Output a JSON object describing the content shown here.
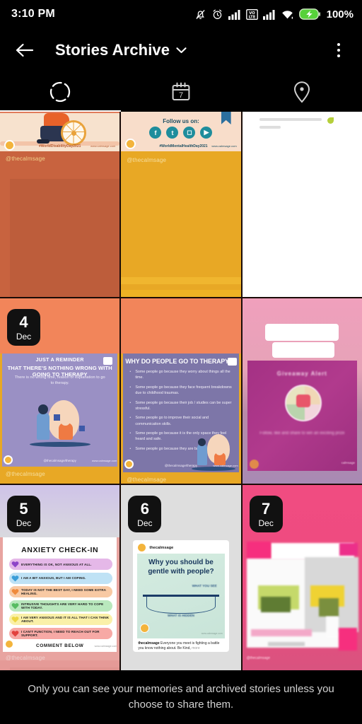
{
  "status_bar": {
    "time": "3:10 PM",
    "battery_percent": "100%",
    "icons": [
      "bell-slash-icon",
      "alarm-clock-icon",
      "signal-bars-icon",
      "volte-icon",
      "signal-bars-2-icon",
      "wifi-icon",
      "battery-charging-icon"
    ],
    "volte_label_top": "VO",
    "volte_label_bottom": "LTE"
  },
  "header": {
    "back_icon": "back-arrow-icon",
    "title": "Stories Archive",
    "chevron_icon": "chevron-down-icon",
    "menu_icon": "kebab-menu-icon"
  },
  "tabs": {
    "items": [
      {
        "name": "stories",
        "icon": "dashed-circle-icon",
        "selected": true
      },
      {
        "name": "calendar",
        "icon": "calendar-icon",
        "label": "7",
        "selected": false
      },
      {
        "name": "map",
        "icon": "location-pin-icon",
        "selected": false
      }
    ]
  },
  "grid": {
    "cells": [
      {
        "id": "cell-1",
        "type": "story-thumb",
        "date": null,
        "watermark": "@thecalmsage",
        "hashtag": "#WorldDisabilityDay2021",
        "site": "www.calmsage.com",
        "bg": "#c8633f"
      },
      {
        "id": "cell-2",
        "type": "story-thumb",
        "date": null,
        "heading": "Follow us on:",
        "socials": [
          "f",
          "t",
          "ig",
          "yt"
        ],
        "hashtag": "#WorldMentalHealthDay2021",
        "site": "www.calmsage.com",
        "watermark": "@thecalmsage",
        "bg": "#e8a825"
      },
      {
        "id": "cell-3",
        "type": "story-thumb",
        "date": null,
        "bg": "#ffffff"
      },
      {
        "id": "cell-4",
        "type": "story-thumb",
        "date": {
          "day": "4",
          "month": "Dec"
        },
        "title_line1": "JUST A REMINDER",
        "title_line2": "THAT THERE'S NOTHING WRONG WITH GOING TO THERAPY",
        "body": "There is no wrong time, reason or explanation to go to therapy.",
        "credit": "@thecalmsage/therapy",
        "site": "www.calmsage.com",
        "watermark": "@thecalmsage",
        "bg": "#e8a825"
      },
      {
        "id": "cell-5",
        "type": "story-thumb",
        "date": null,
        "title": "WHY DO PEOPLE GO TO THERAPY",
        "bullets": [
          "Some people go because they worry about things all the time.",
          "Some people go because they face frequent breakdowns due to childhood traumas.",
          "Some people go because their job / studies can be super stressful.",
          "Some people go to improve their social and communication skills.",
          "Some people go because it is the only space they feel heard and safe.",
          "Some people go because they are bad at focusing."
        ],
        "credit": "@thecalmsage/therapy",
        "site": "www.calmsage.com",
        "watermark": "@thecalmsage",
        "bg": "#e8a825"
      },
      {
        "id": "cell-6",
        "type": "story-thumb",
        "date": null,
        "title": "Giveaway Alert",
        "body": "Follow, like and share to win an exciting prize",
        "site": "calmsage",
        "bg": "#e6a2b8"
      },
      {
        "id": "cell-7",
        "type": "story-thumb",
        "date": {
          "day": "5",
          "month": "Dec"
        },
        "title": "ANXIETY CHECK-IN",
        "rows": [
          {
            "color": "#e5b8e8",
            "heart": "#8e44c8",
            "text": "EVERYTHING IS OK, NOT ANXIOUS AT ALL."
          },
          {
            "color": "#bfe2f5",
            "heart": "#3b9ed8",
            "text": "I AM A BIT ANXIOUS, BUT I AM COPING."
          },
          {
            "color": "#f8c9a3",
            "heart": "#ef8a3c",
            "text": "TODAY IS NOT THE BEST DAY, I NEED SOME EXTRA HEALING."
          },
          {
            "color": "#b9e8bd",
            "heart": "#57bc62",
            "text": "INTRUSIVE THOUGHTS ARE VERY HARD TO COPE WITH TODAY."
          },
          {
            "color": "#faf0a8",
            "heart": "#ecd544",
            "text": "I AM VERY ANXIOUS AND IT IS ALL THAT I CAN THINK ABOUT."
          },
          {
            "color": "#f7a9a5",
            "heart": "#e2413d",
            "text": "I CAN'T FUNCTION, I NEED TO REACH OUT FOR SUPPORT."
          }
        ],
        "footer": "COMMENT BELOW",
        "site": "www.calmsage.com",
        "watermark": "@thecalmsage",
        "bg": "#e8a4a0"
      },
      {
        "id": "cell-8",
        "type": "story-thumb",
        "date": {
          "day": "6",
          "month": "Dec"
        },
        "post_author": "thecalmsage",
        "quote_line1": "Why you should be",
        "quote_line2": "gentle with people?",
        "label_top": "WHAT YOU SEE",
        "label_bottom": "WHAT IS HIDDEN",
        "caption_author": "thecalmsage",
        "caption": "Everyone you meet is fighting a battle you know nothing about. Be Kind,",
        "caption_more": "more",
        "site": "www.calmsage.com",
        "bg": "#dedede"
      },
      {
        "id": "cell-9",
        "type": "story-thumb",
        "date": {
          "day": "7",
          "month": "Dec"
        },
        "watermark": "@thecalmsage",
        "bg": "#ef4b80"
      }
    ]
  },
  "footer": {
    "note": "Only you can see your memories and archived stories unless you choose to share them."
  },
  "colors": {
    "background": "#000000",
    "text_primary": "#ffffff",
    "text_secondary": "#d2d2d2",
    "battery_green": "#57d13a",
    "tab_indicator": "#ffffff"
  }
}
